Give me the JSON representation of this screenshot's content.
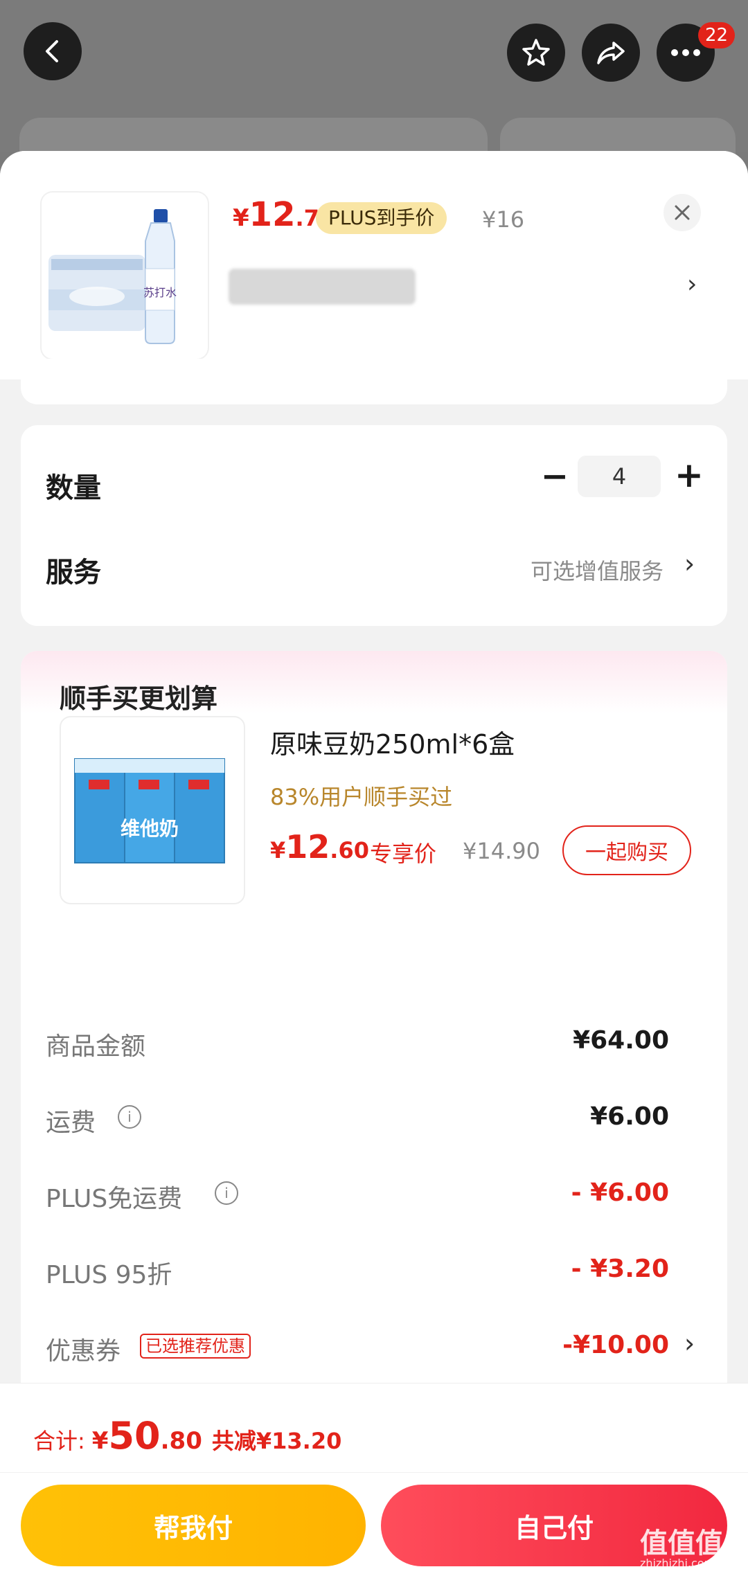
{
  "header": {
    "badge_count": "22"
  },
  "product": {
    "price_symbol": "¥",
    "price_int": "12",
    "price_dec": ".7",
    "plus_tag": "PLUS到手价",
    "original_price": "¥16",
    "thumb_text": "苏打水"
  },
  "quantity": {
    "label": "数量",
    "minus": "−",
    "value": "4",
    "plus": "+"
  },
  "service": {
    "label": "服务",
    "hint": "可选增值服务"
  },
  "addon": {
    "title": "顺手买更划算",
    "item_name": "原味豆奶250ml*6盒",
    "social_proof": "83%用户顺手买过",
    "price_symbol": "¥",
    "price_int": "12",
    "price_dec": ".60",
    "price_tag": "专享价",
    "original_price": "¥14.90",
    "buy_button": "一起购买",
    "thumb_text": "维他奶"
  },
  "summary": {
    "rows": [
      {
        "label": "商品金额",
        "value": "¥64.00"
      },
      {
        "label": "运费",
        "value": "¥6.00"
      },
      {
        "label": "PLUS免运费",
        "value": "- ¥6.00"
      },
      {
        "label": "PLUS 95折",
        "value": "- ¥3.20"
      },
      {
        "label": "优惠券",
        "tag": "已选推荐优惠",
        "value": "-¥10.00"
      }
    ]
  },
  "footer": {
    "total_label": "合计:",
    "total_symbol": "¥",
    "total_int": "50",
    "total_dec": ".80",
    "discount_text": "共减¥13.20",
    "help_pay": "帮我付",
    "self_pay": "自己付"
  },
  "watermark": {
    "text": "值值值",
    "url": "zhizhizhi.com"
  },
  "colors": {
    "accent_red": "#e2231a",
    "plus_gold": "#f9e5a4",
    "help_yellow": "#ffc107",
    "pay_red": "#f2283f"
  }
}
